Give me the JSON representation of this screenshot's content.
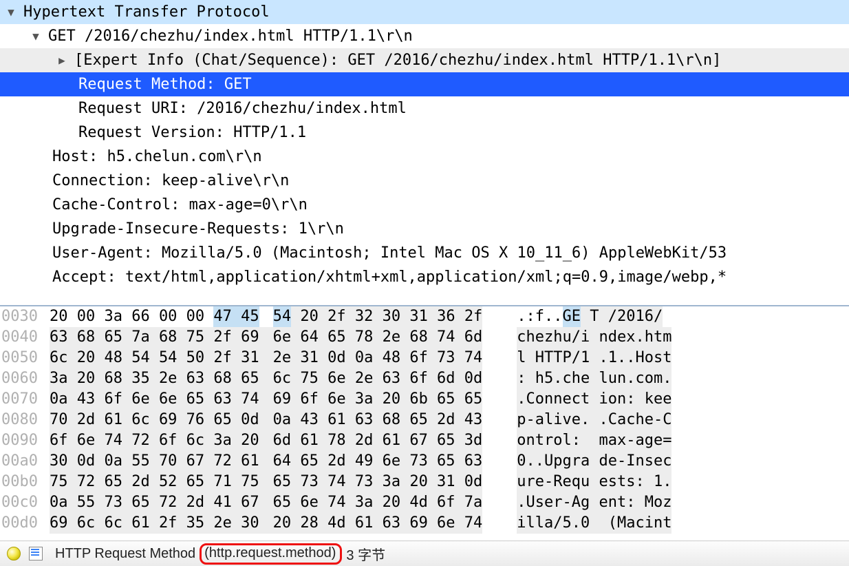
{
  "tree": {
    "root": "Hypertext Transfer Protocol",
    "request_line": "GET /2016/chezhu/index.html HTTP/1.1\\r\\n",
    "expert_info": "[Expert Info (Chat/Sequence): GET /2016/chezhu/index.html HTTP/1.1\\r\\n]",
    "request_method": "Request Method: GET",
    "request_uri": "Request URI: /2016/chezhu/index.html",
    "request_version": "Request Version: HTTP/1.1",
    "host": "Host: h5.chelun.com\\r\\n",
    "connection": "Connection: keep-alive\\r\\n",
    "cache_control": "Cache-Control: max-age=0\\r\\n",
    "upgrade": "Upgrade-Insecure-Requests: 1\\r\\n",
    "user_agent": "User-Agent: Mozilla/5.0 (Macintosh; Intel Mac OS X 10_11_6) AppleWebKit/53",
    "accept": "Accept: text/html,application/xhtml+xml,application/xml;q=0.9,image/webp,*"
  },
  "hex": [
    {
      "off": "0030",
      "l": "20 00 3a 66 00 00 ",
      "m1": "47 45",
      "m2": "54",
      "r": " 20 2f 32 30 31 36 2f",
      "a1": ".:f..",
      "a2": "GE",
      "a3": " T /2016/",
      "sel": true
    },
    {
      "off": "0040",
      "l": "63 68 65 7a 68 75 2f 69",
      "r": "6e 64 65 78 2e 68 74 6d",
      "a1": "chezhu/i",
      "a3": " ndex.htm"
    },
    {
      "off": "0050",
      "l": "6c 20 48 54 54 50 2f 31",
      "r": "2e 31 0d 0a 48 6f 73 74",
      "a1": "l HTTP/1",
      "a3": " .1..Host"
    },
    {
      "off": "0060",
      "l": "3a 20 68 35 2e 63 68 65",
      "r": "6c 75 6e 2e 63 6f 6d 0d",
      "a1": ": h5.che",
      "a3": " lun.com."
    },
    {
      "off": "0070",
      "l": "0a 43 6f 6e 6e 65 63 74",
      "r": "69 6f 6e 3a 20 6b 65 65",
      "a1": ".Connect",
      "a3": " ion: kee"
    },
    {
      "off": "0080",
      "l": "70 2d 61 6c 69 76 65 0d",
      "r": "0a 43 61 63 68 65 2d 43",
      "a1": "p-alive.",
      "a3": " .Cache-C"
    },
    {
      "off": "0090",
      "l": "6f 6e 74 72 6f 6c 3a 20",
      "r": "6d 61 78 2d 61 67 65 3d",
      "a1": "ontrol: ",
      "a3": " max-age="
    },
    {
      "off": "00a0",
      "l": "30 0d 0a 55 70 67 72 61",
      "r": "64 65 2d 49 6e 73 65 63",
      "a1": "0..Upgra",
      "a3": " de-Insec"
    },
    {
      "off": "00b0",
      "l": "75 72 65 2d 52 65 71 75",
      "r": "65 73 74 73 3a 20 31 0d",
      "a1": "ure-Requ",
      "a3": " ests: 1."
    },
    {
      "off": "00c0",
      "l": "0a 55 73 65 72 2d 41 67",
      "r": "65 6e 74 3a 20 4d 6f 7a",
      "a1": ".User-Ag",
      "a3": " ent: Moz"
    },
    {
      "off": "00d0",
      "l": "69 6c 6c 61 2f 35 2e 30",
      "r": "20 28 4d 61 63 69 6e 74",
      "a1": "illa/5.0",
      "a3": "  (Macint"
    }
  ],
  "status": {
    "label": "HTTP Request Method ",
    "field": "(http.request.method)",
    "bytes": " 3 字节"
  }
}
